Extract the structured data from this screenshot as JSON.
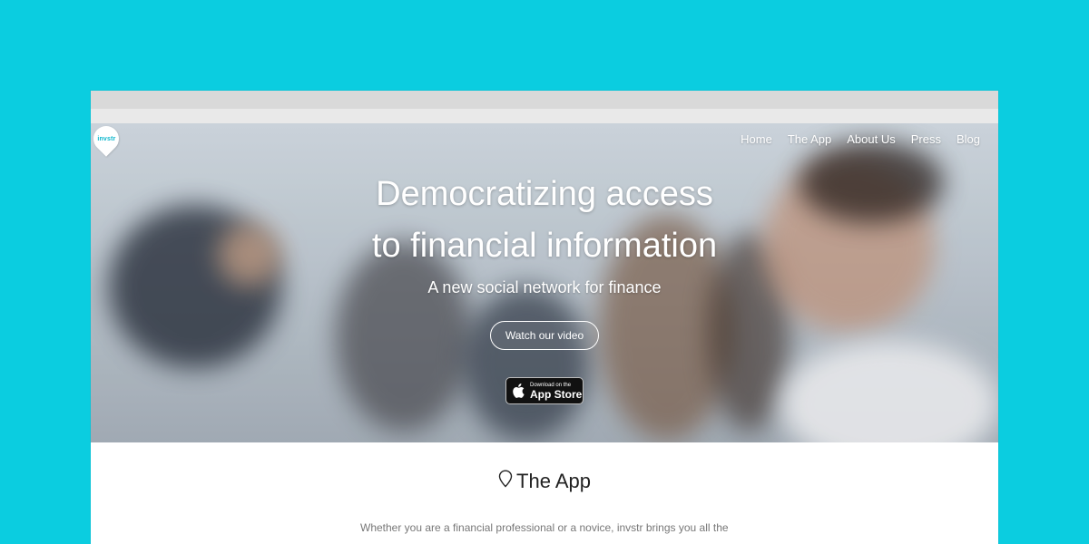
{
  "brand": {
    "logo_text": "invstr"
  },
  "nav": {
    "items": [
      {
        "label": "Home"
      },
      {
        "label": "The App"
      },
      {
        "label": "About Us"
      },
      {
        "label": "Press"
      },
      {
        "label": "Blog"
      }
    ]
  },
  "hero": {
    "headline_line1": "Democratizing access",
    "headline_line2": "to financial information",
    "subheadline": "A new social network for finance",
    "video_button": "Watch our video",
    "appstore_small": "Download on the",
    "appstore_big": "App Store"
  },
  "section": {
    "title": "The App",
    "body_line1": "Whether you are a financial professional or a novice, invstr brings you all the"
  },
  "colors": {
    "background": "#0bcde0",
    "chrome": "#d9d9d9",
    "text_dark": "#222222",
    "text_muted": "#777777"
  },
  "icons": {
    "logo": "invstr-pin-logo",
    "apple": "apple-icon",
    "section_marker": "pin-outline-icon"
  }
}
